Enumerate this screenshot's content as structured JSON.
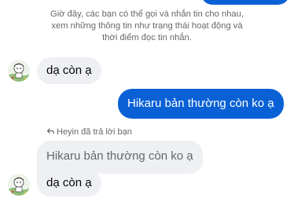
{
  "colors": {
    "accent_blue": "#0a61d6",
    "incoming_bubble": "#eef0f3",
    "muted_text": "#65676b"
  },
  "system_notice": {
    "line1": "Giờ đây, các bạn có thể gọi và nhắn tin cho nhau,",
    "line2": "xem những thông tin như trạng thái hoạt động và",
    "line3": "thời điểm đọc tin nhắn."
  },
  "messages": [
    {
      "direction": "incoming",
      "text": "dạ còn ạ"
    },
    {
      "direction": "outgoing",
      "text": "Hikaru bản thường còn ko ạ"
    },
    {
      "direction": "incoming",
      "reply_label": "Heyin đã trả lời bạn",
      "quoted_text": "Hikaru bản thường còn ko ạ",
      "text": "dạ còn ạ"
    }
  ],
  "icons": {
    "reply": "reply-arrow-icon",
    "avatar": "user-avatar"
  }
}
